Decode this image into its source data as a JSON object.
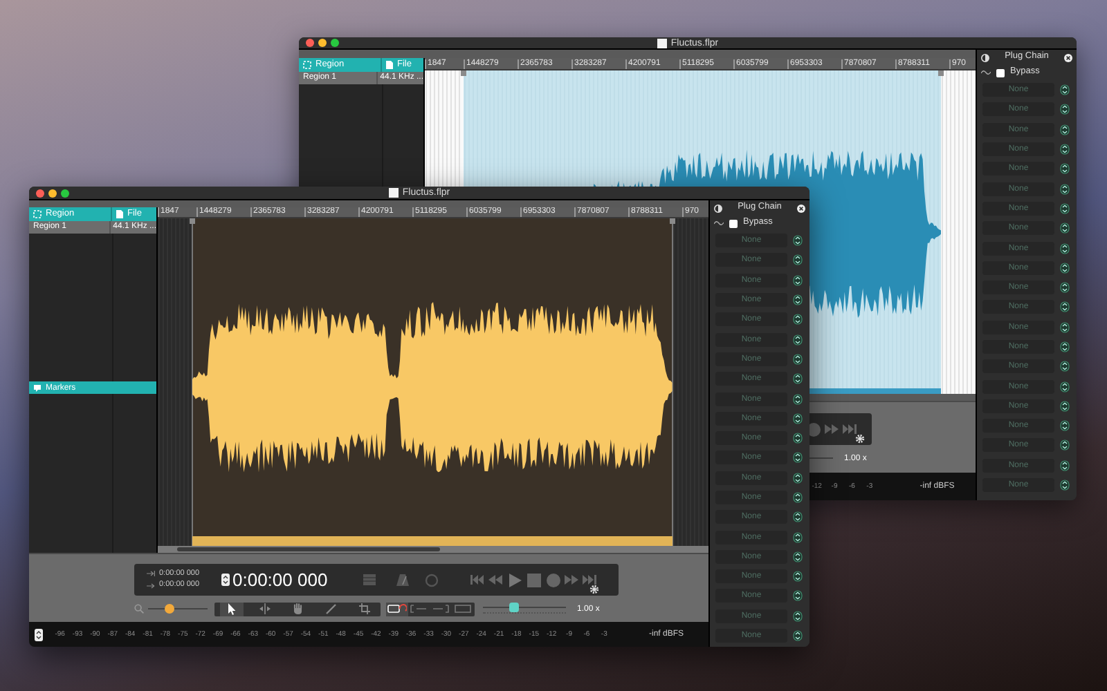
{
  "back_window": {
    "title": "Fluctus.flpr",
    "region_columns": [
      "Region",
      "File"
    ],
    "region_rows": [
      {
        "region": "Region 1",
        "file": "44.1 KHz ..."
      }
    ],
    "ruler_labels": [
      "1847",
      "1448279",
      "2365783",
      "3283287",
      "4200791",
      "5118295",
      "6035799",
      "6953303",
      "7870807",
      "8788311",
      "970"
    ],
    "transport": {
      "speed_reading": "1.00 x"
    },
    "meter": {
      "labels": [
        "-12",
        "-9",
        "-6",
        "-3"
      ],
      "reading": "-inf dBFS"
    },
    "plug_chain": {
      "title": "Plug Chain",
      "bypass": {
        "label": "Bypass",
        "checked": false
      },
      "slots": [
        "None",
        "None",
        "None",
        "None",
        "None",
        "None",
        "None",
        "None",
        "None",
        "None",
        "None",
        "None",
        "None",
        "None",
        "None",
        "None",
        "None",
        "None",
        "None",
        "None",
        "None"
      ]
    }
  },
  "front_window": {
    "title": "Fluctus.flpr",
    "region_columns": [
      "Region",
      "File"
    ],
    "region_rows": [
      {
        "region": "Region 1",
        "file": "44.1 KHz ..."
      }
    ],
    "markers": "Markers",
    "ruler_labels": [
      "1847",
      "1448279",
      "2365783",
      "3283287",
      "4200791",
      "5118295",
      "6035799",
      "6953303",
      "7870807",
      "8788311",
      "970"
    ],
    "transport": {
      "in_time": "0:00:00 000",
      "out_time": "0:00:00 000",
      "position": "0:00:00 000",
      "zoom": {
        "level": 0.33
      },
      "tools": [
        {
          "kind": "pointer",
          "selected": true
        },
        {
          "kind": "trim",
          "selected": false
        },
        {
          "kind": "hand",
          "selected": false
        },
        {
          "kind": "pencil",
          "selected": false
        },
        {
          "kind": "crop",
          "selected": false
        }
      ],
      "loop_modes": [
        {
          "kind": "loop",
          "selected": true
        },
        {
          "kind": "loop-in",
          "selected": false
        },
        {
          "kind": "loop-out",
          "selected": false
        },
        {
          "kind": "loop-range",
          "selected": false
        }
      ],
      "speed": {
        "level": 0.35,
        "reading": "1.00 x"
      }
    },
    "meter": {
      "labels": [
        "-96",
        "-93",
        "-90",
        "-87",
        "-84",
        "-81",
        "-78",
        "-75",
        "-72",
        "-69",
        "-66",
        "-63",
        "-60",
        "-57",
        "-54",
        "-51",
        "-48",
        "-45",
        "-42",
        "-39",
        "-36",
        "-33",
        "-30",
        "-27",
        "-24",
        "-21",
        "-18",
        "-15",
        "-12",
        "-9",
        "-6",
        "-3"
      ],
      "reading": "-inf dBFS"
    },
    "plug_chain": {
      "title": "Plug Chain",
      "bypass": {
        "label": "Bypass",
        "checked": false
      },
      "slots": [
        "None",
        "None",
        "None",
        "None",
        "None",
        "None",
        "None",
        "None",
        "None",
        "None",
        "None",
        "None",
        "None",
        "None",
        "None",
        "None",
        "None",
        "None",
        "None",
        "None",
        "None"
      ]
    }
  }
}
